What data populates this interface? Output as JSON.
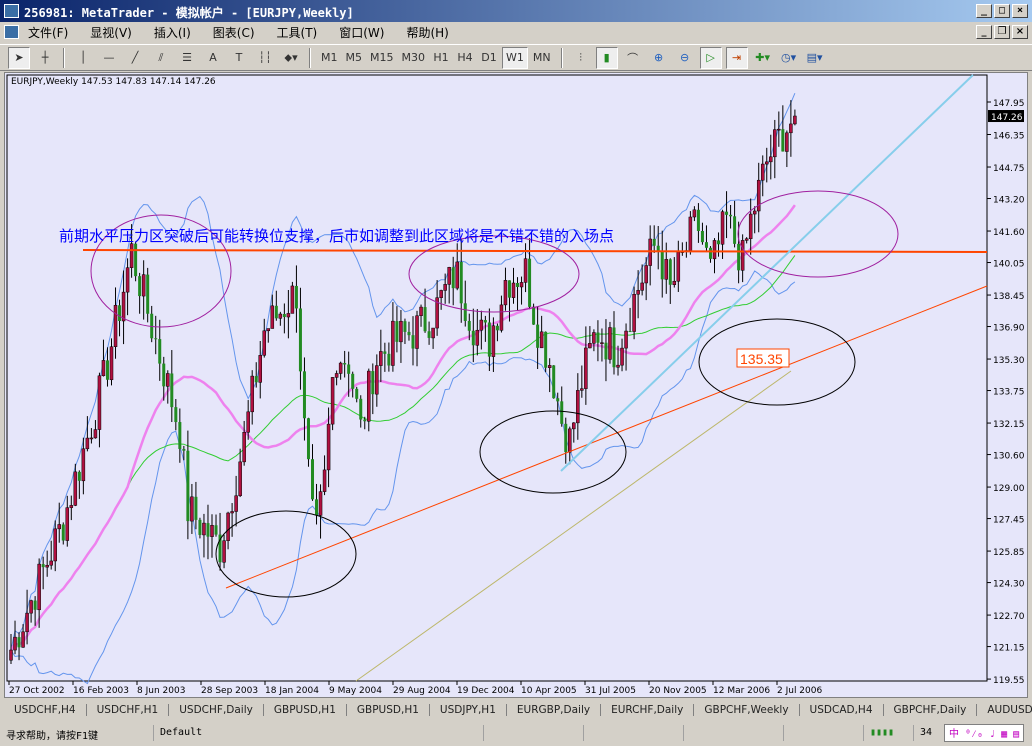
{
  "window": {
    "title": "256981: MetaTrader - 模拟帐户 - [EURJPY,Weekly]"
  },
  "menu": [
    "文件(F)",
    "显视(V)",
    "插入(I)",
    "图表(C)",
    "工具(T)",
    "窗口(W)",
    "帮助(H)"
  ],
  "toolbar": {
    "timeframes": [
      "M1",
      "M5",
      "M15",
      "M30",
      "H1",
      "H4",
      "D1",
      "W1",
      "MN"
    ],
    "active": "W1",
    "text_tool": "A"
  },
  "chart": {
    "symbol_info": "EURJPY,Weekly  147.53 147.83 147.14 147.26",
    "current_price": "147.26",
    "price_ticks": [
      "147.95",
      "146.35",
      "144.75",
      "143.20",
      "141.60",
      "140.05",
      "138.45",
      "136.90",
      "135.30",
      "133.75",
      "132.15",
      "130.60",
      "129.00",
      "127.45",
      "125.85",
      "124.30",
      "122.70",
      "121.15",
      "119.55"
    ],
    "time_ticks": [
      "27 Oct 2002",
      "16 Feb 2003",
      "8 Jun 2003",
      "28 Sep 2003",
      "18 Jan 2004",
      "9 May 2004",
      "29 Aug 2004",
      "19 Dec 2004",
      "10 Apr 2005",
      "31 Jul 2005",
      "20 Nov 2005",
      "12 Mar 2006",
      "2 Jul 2006"
    ],
    "annotation_text": "前期水平压力区突破后可能转换位支撑，后市如调整到此区域将是不错不错的入场点",
    "price_label": "135.35",
    "colors": {
      "bg": "#e6e6fa",
      "bull": "#b01040",
      "bear": "#228b22",
      "ma_fast": "#ee82ee",
      "ma_slow": "#32cd32",
      "bands": "#6495ed",
      "hline": "#ff4500",
      "text": "#0000ff"
    },
    "approx_closes": [
      [
        "2002-10-27",
        121.0
      ],
      [
        "2002-12-01",
        123.4
      ],
      [
        "2003-01-26",
        127.3
      ],
      [
        "2003-04-06",
        134.2
      ],
      [
        "2003-05-25",
        140.6
      ],
      [
        "2003-07-01",
        136.7
      ],
      [
        "2003-08-17",
        131.8
      ],
      [
        "2003-08-31",
        127.9
      ],
      [
        "2003-10-26",
        126.1
      ],
      [
        "2003-12-07",
        131.3
      ],
      [
        "2004-01-11",
        136.7
      ],
      [
        "2004-03-07",
        138.6
      ],
      [
        "2004-03-21",
        131.8
      ],
      [
        "2004-04-08",
        126.1
      ],
      [
        "2004-04-25",
        129.3
      ],
      [
        "2004-05-13",
        135.7
      ],
      [
        "2004-06-06",
        135.2
      ],
      [
        "2004-06-27",
        131.8
      ],
      [
        "2004-07-22",
        135.2
      ],
      [
        "2004-08-26",
        136.2
      ],
      [
        "2004-09-30",
        136.7
      ],
      [
        "2004-11-04",
        137.7
      ],
      [
        "2004-12-09",
        139.6
      ],
      [
        "2005-01-13",
        136.7
      ],
      [
        "2005-02-06",
        136.2
      ],
      [
        "2005-03-06",
        139.2
      ],
      [
        "2005-04-10",
        139.6
      ],
      [
        "2005-04-28",
        137.2
      ],
      [
        "2005-05-22",
        135.2
      ],
      [
        "2005-06-12",
        132.3
      ],
      [
        "2005-06-26",
        131.3
      ],
      [
        "2005-07-17",
        134.2
      ],
      [
        "2005-08-11",
        136.7
      ],
      [
        "2005-09-15",
        135.7
      ],
      [
        "2005-10-20",
        138.6
      ],
      [
        "2005-11-24",
        141.1
      ],
      [
        "2005-12-18",
        138.6
      ],
      [
        "2006-02-02",
        142.1
      ],
      [
        "2006-02-26",
        139.6
      ],
      [
        "2006-03-26",
        142.1
      ],
      [
        "2006-04-23",
        140.1
      ],
      [
        "2006-05-07",
        142.1
      ],
      [
        "2006-06-04",
        145.0
      ],
      [
        "2006-07-02",
        146.5
      ],
      [
        "2006-07-26",
        147.26
      ]
    ]
  },
  "tabs": [
    "USDCHF,H4",
    "USDCHF,H1",
    "USDCHF,Daily",
    "GBPUSD,H1",
    "GBPUSD,H1",
    "USDJPY,H1",
    "EURGBP,Daily",
    "EURCHF,Daily",
    "GBPCHF,Weekly",
    "USDCAD,H4",
    "GBPCHF,Daily",
    "AUDUSD,"
  ],
  "status": {
    "help": "寻求帮助，请按F1键",
    "profile": "Default",
    "traffic": "34"
  }
}
